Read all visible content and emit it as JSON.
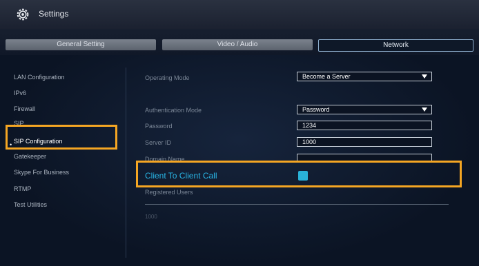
{
  "window": {
    "title": "Settings"
  },
  "tabs": [
    {
      "label": "General Setting"
    },
    {
      "label": "Video / Audio"
    },
    {
      "label": "Network"
    }
  ],
  "sidebar": {
    "items": [
      {
        "label": "LAN Configuration"
      },
      {
        "label": "IPv6"
      },
      {
        "label": "Firewall"
      },
      {
        "label": "SIP"
      },
      {
        "label": "SIP Configuration"
      },
      {
        "label": "Gatekeeper"
      },
      {
        "label": "Skype For Business"
      },
      {
        "label": "RTMP"
      },
      {
        "label": "Test Utilities"
      }
    ],
    "active_marker": "•"
  },
  "form": {
    "operating_mode": {
      "label": "Operating Mode",
      "value": "Become a Server"
    },
    "authentication_mode": {
      "label": "Authentication Mode",
      "value": "Password"
    },
    "password": {
      "label": "Password",
      "value": "1234"
    },
    "server_id": {
      "label": "Server ID",
      "value": "1000"
    },
    "domain_name": {
      "label": "Domain Name",
      "value": ""
    },
    "client_to_client": {
      "label": "Client To Client Call",
      "checked": true
    },
    "registered_users": {
      "label": "Registered Users",
      "value": "1000"
    }
  },
  "colors": {
    "highlight": "#f5a623",
    "accent": "#29b6e6"
  },
  "icons": {
    "settings": "gear-icon",
    "dropdown": "chevron-down-icon"
  }
}
